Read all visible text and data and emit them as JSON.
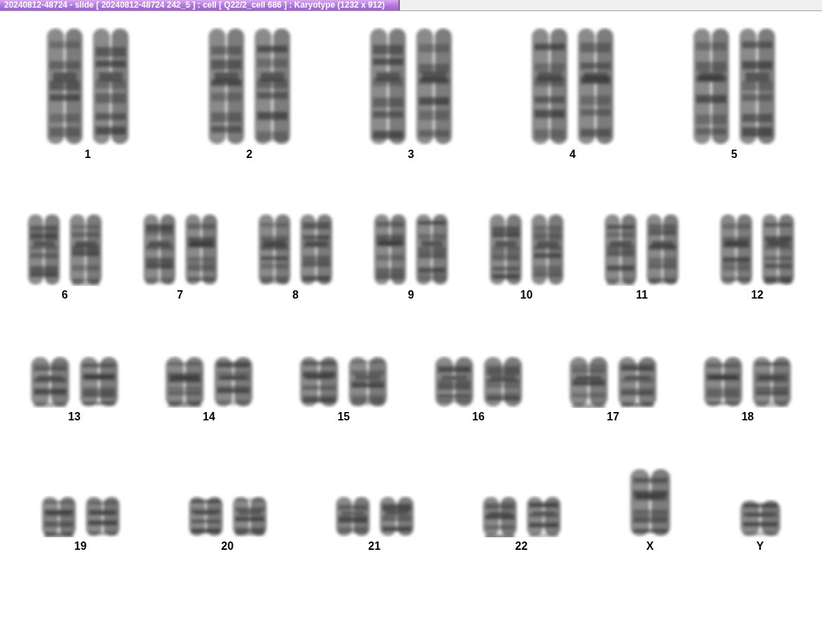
{
  "window": {
    "title": "20240812-48724 - slide [ 20240812-48724 242_5 ] : cell [ Q22/2_cell 686 ] : Karyotype  (1232 x 912)"
  },
  "rows": [
    {
      "chromosomes": [
        {
          "label": "1",
          "kind": "pair"
        },
        {
          "label": "2",
          "kind": "pair"
        },
        {
          "label": "3",
          "kind": "pair"
        },
        {
          "label": "4",
          "kind": "pair"
        },
        {
          "label": "5",
          "kind": "pair"
        }
      ]
    },
    {
      "chromosomes": [
        {
          "label": "6",
          "kind": "pair"
        },
        {
          "label": "7",
          "kind": "pair"
        },
        {
          "label": "8",
          "kind": "pair"
        },
        {
          "label": "9",
          "kind": "pair"
        },
        {
          "label": "10",
          "kind": "pair"
        },
        {
          "label": "11",
          "kind": "pair"
        },
        {
          "label": "12",
          "kind": "pair"
        }
      ]
    },
    {
      "chromosomes": [
        {
          "label": "13",
          "kind": "pair"
        },
        {
          "label": "14",
          "kind": "pair"
        },
        {
          "label": "15",
          "kind": "pair"
        },
        {
          "label": "16",
          "kind": "pair"
        },
        {
          "label": "17",
          "kind": "pair"
        },
        {
          "label": "18",
          "kind": "pair"
        }
      ]
    },
    {
      "chromosomes": [
        {
          "label": "19",
          "kind": "pair"
        },
        {
          "label": "20",
          "kind": "pair"
        },
        {
          "label": "21",
          "kind": "pair"
        },
        {
          "label": "22",
          "kind": "pair"
        },
        {
          "label": "X",
          "kind": "single"
        },
        {
          "label": "Y",
          "kind": "single"
        }
      ]
    }
  ]
}
